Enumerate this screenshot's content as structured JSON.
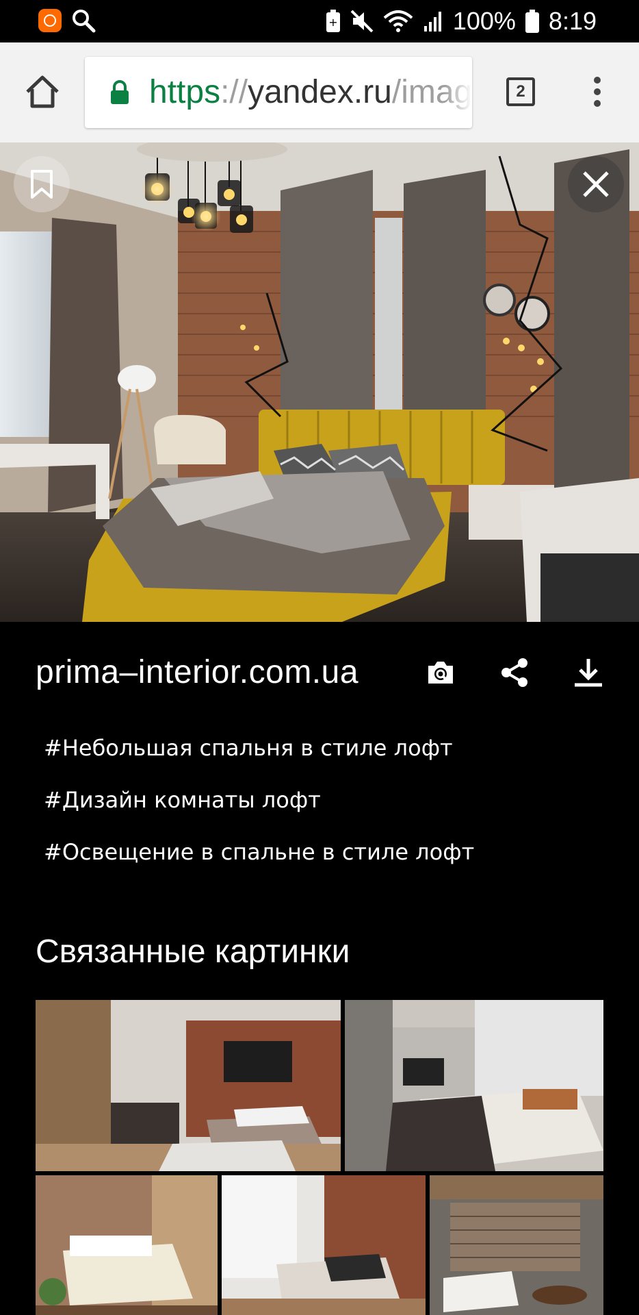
{
  "status_bar": {
    "battery": "100%",
    "time": "8:19"
  },
  "browser": {
    "url_scheme": "https",
    "url_sep": "://",
    "url_host": "yandex.ru",
    "url_path": "/images/",
    "tab_count": "2"
  },
  "image": {
    "source_domain": "prima–interior.com.ua"
  },
  "tags": [
    "#Небольшая спальня в стиле лофт",
    "#Дизайн комнаты лофт",
    "#Освещение в спальне в стиле лофт"
  ],
  "related": {
    "title": "Связанные картинки"
  },
  "colors": {
    "status_icon_accent": "#ff6a00",
    "lock_green": "#0b8043",
    "bed_yellow": "#c9a21c"
  },
  "icons": [
    "mi-icon",
    "search-icon",
    "battery-saver-icon",
    "mute-icon",
    "wifi-icon",
    "signal-icon",
    "battery-icon",
    "home-icon",
    "lock-icon",
    "tab-switcher-icon",
    "overflow-menu-icon",
    "bookmark-icon",
    "close-icon",
    "camera-search-icon",
    "share-icon",
    "download-icon"
  ]
}
